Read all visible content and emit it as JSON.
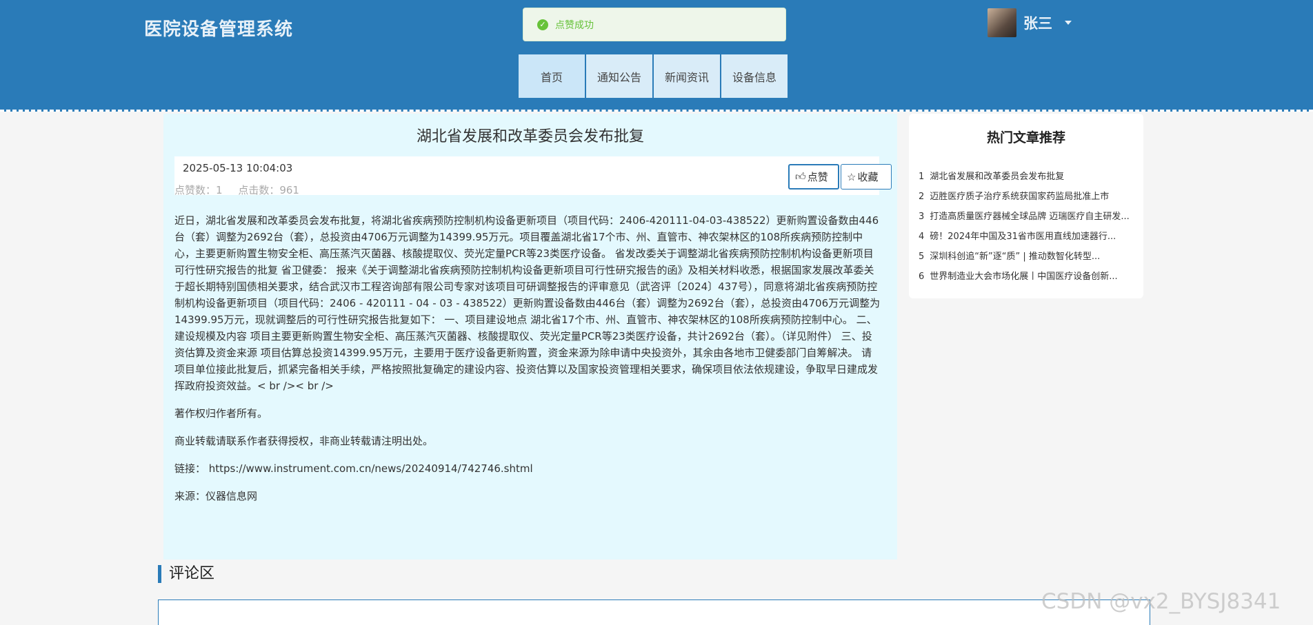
{
  "header": {
    "brand": "医院设备管理系统",
    "toast": "点赞成功",
    "nav": [
      "首页",
      "通知公告",
      "新闻资讯",
      "设备信息"
    ],
    "user": {
      "name": "张三"
    }
  },
  "article": {
    "title": "湖北省发展和改革委员会发布批复",
    "datetime": "2025-05-13 10:04:03",
    "likes_label": "点赞数：1",
    "clicks_label": "点击数：961",
    "like_button": "点赞",
    "favorite_button": "收藏",
    "body": "近日，湖北省发展和改革委员会发布批复，将湖北省疾病预防控制机构设备更新项目（项目代码：2406-420111-04-03-438522）更新购置设备数由446台（套）调整为2692台（套），总投资由4706万元调整为14399.95万元。项目覆盖湖北省17个市、州、直管市、神农架林区的108所疾病预防控制中心，主要更新购置生物安全柜、高压蒸汽灭菌器、核酸提取仪、荧光定量PCR等23类医疗设备。 省发改委关于调整湖北省疾病预防控制机构设备更新项目可行性研究报告的批复 省卫健委： 报来《关于调整湖北省疾病预防控制机构设备更新项目可行性研究报告的函》及相关材料收悉，根据国家发展改革委关于超长期特别国债相关要求，结合武汉市工程咨询部有限公司专家对该项目可研调整报告的评审意见（武咨评〔2024〕437号），同意将湖北省疾病预防控制机构设备更新项目（项目代码：2406 - 420111 - 04 - 03 - 438522）更新购置设备数由446台（套）调整为2692台（套），总投资由4706万元调整为14399.95万元，现就调整后的可行性研究报告批复如下： 一、项目建设地点 湖北省17个市、州、直管市、神农架林区的108所疾病预防控制中心。 二、建设规模及内容 项目主要更新购置生物安全柜、高压蒸汽灭菌器、核酸提取仪、荧光定量PCR等23类医疗设备，共计2692台（套）。（详见附件） 三、投资估算及资金来源 项目估算总投资14399.95万元，主要用于医疗设备更新购置，资金来源为除申请中央投资外，其余由各地市卫健委部门自筹解决。 请项目单位接此批复后，抓紧完备相关手续，严格按照批复确定的建设内容、投资估算以及国家投资管理相关要求，确保项目依法依规建设，争取早日建成发挥政府投资效益。< br />< br />",
    "copyright": "著作权归作者所有。",
    "reprint": "商业转载请联系作者获得授权，非商业转载请注明出处。",
    "link": "链接： https://www.instrument.com.cn/news/20240914/742746.shtml",
    "source": "来源：仪器信息网"
  },
  "sidebar": {
    "title": "热门文章推荐",
    "items": [
      {
        "num": "1",
        "text": "湖北省发展和改革委员会发布批复"
      },
      {
        "num": "2",
        "text": "迈胜医疗质子治疗系统获国家药监局批准上市"
      },
      {
        "num": "3",
        "text": "打造高质量医疗器械全球品牌 迈瑞医疗自主研发..."
      },
      {
        "num": "4",
        "text": "磅！2024年中国及31省市医用直线加速器行..."
      },
      {
        "num": "5",
        "text": "深圳科创追“新”逐“质” | 推动数智化转型..."
      },
      {
        "num": "6",
        "text": "世界制造业大会市场化展丨中国医疗设备创新..."
      }
    ]
  },
  "comments": {
    "title": "评论区"
  },
  "watermark": "CSDN @vx2_BYSJ8341"
}
